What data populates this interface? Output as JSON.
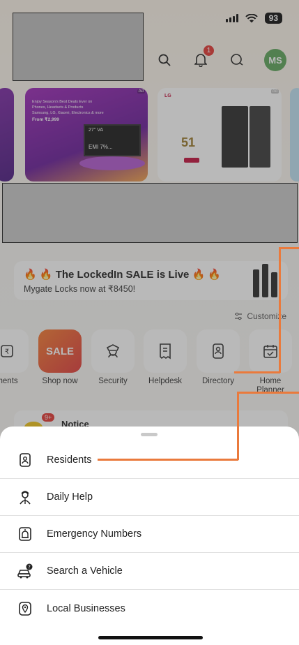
{
  "status": {
    "battery": "93"
  },
  "header": {
    "notification_count": "1",
    "avatar_initials": "MS"
  },
  "ads": {
    "tag": "Ad",
    "festive": {
      "line1": "Enjoy Season's Best Deals Ever on",
      "line2": "Phones, Headsets & Products",
      "line3": "Samsung, LG, Xiaomi, Electronics & more",
      "price": "From ₹2,999",
      "tv_text": "27\" VA",
      "emi": "EMI 7%..."
    },
    "lg": {
      "logo": "LG",
      "number": "51"
    }
  },
  "sale_card": {
    "title": "🔥 🔥 The LockedIn SALE is Live 🔥 🔥",
    "subtitle": "Mygate Locks now at ₹8450!"
  },
  "customize_label": "Customize",
  "quick_actions": [
    {
      "label": "ments"
    },
    {
      "label": "Shop now",
      "tile_text": "SALE"
    },
    {
      "label": "Security"
    },
    {
      "label": "Helpdesk"
    },
    {
      "label": "Directory"
    },
    {
      "label": "Home Planner"
    }
  ],
  "notice": {
    "badge": "9+",
    "label": "Notice"
  },
  "sheet": {
    "items": [
      {
        "label": "Residents",
        "icon": "resident-id-icon"
      },
      {
        "label": "Daily Help",
        "icon": "daily-help-icon"
      },
      {
        "label": "Emergency Numbers",
        "icon": "emergency-icon"
      },
      {
        "label": "Search a Vehicle",
        "icon": "vehicle-search-icon"
      },
      {
        "label": "Local Businesses",
        "icon": "location-pin-icon"
      }
    ]
  },
  "colors": {
    "accent_orange": "#ea7a3c",
    "avatar_green": "#5ea65c",
    "badge_red": "#e53935"
  }
}
